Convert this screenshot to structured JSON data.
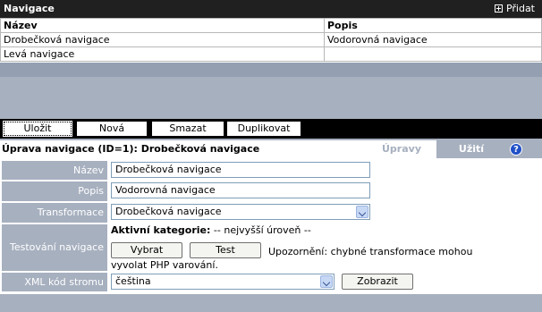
{
  "list": {
    "title": "Navigace",
    "add_label": "Přidat",
    "columns": [
      "Název",
      "Popis"
    ],
    "rows": [
      {
        "name": "Drobečková navigace",
        "desc": "Vodorovná navigace"
      },
      {
        "name": "Levá navigace",
        "desc": ""
      }
    ]
  },
  "toolbar": {
    "save": "Uložit",
    "new": "Nová",
    "delete": "Smazat",
    "duplicate": "Duplikovat"
  },
  "edit": {
    "title": "Úprava navigace (ID=1): Drobečková navigace",
    "tabs": [
      "Úpravy",
      "Užití"
    ],
    "help": "?",
    "fields": {
      "name_label": "Název",
      "name_value": "Drobečková navigace",
      "desc_label": "Popis",
      "desc_value": "Vodorovná navigace",
      "transform_label": "Transformace",
      "transform_value": "Drobečková navigace",
      "test_label": "Testování navigace",
      "active_cat_label": "Aktivní kategorie:",
      "active_cat_value": "-- nejvyšší úroveň --",
      "select_button": "Vybrat",
      "test_button": "Test",
      "warning_line1": "Upozornění: chybné transformace mohou",
      "warning_line2": "vyvolat PHP varování.",
      "xml_label": "XML kód stromu",
      "xml_value": "čeština",
      "show_button": "Zobrazit"
    }
  }
}
